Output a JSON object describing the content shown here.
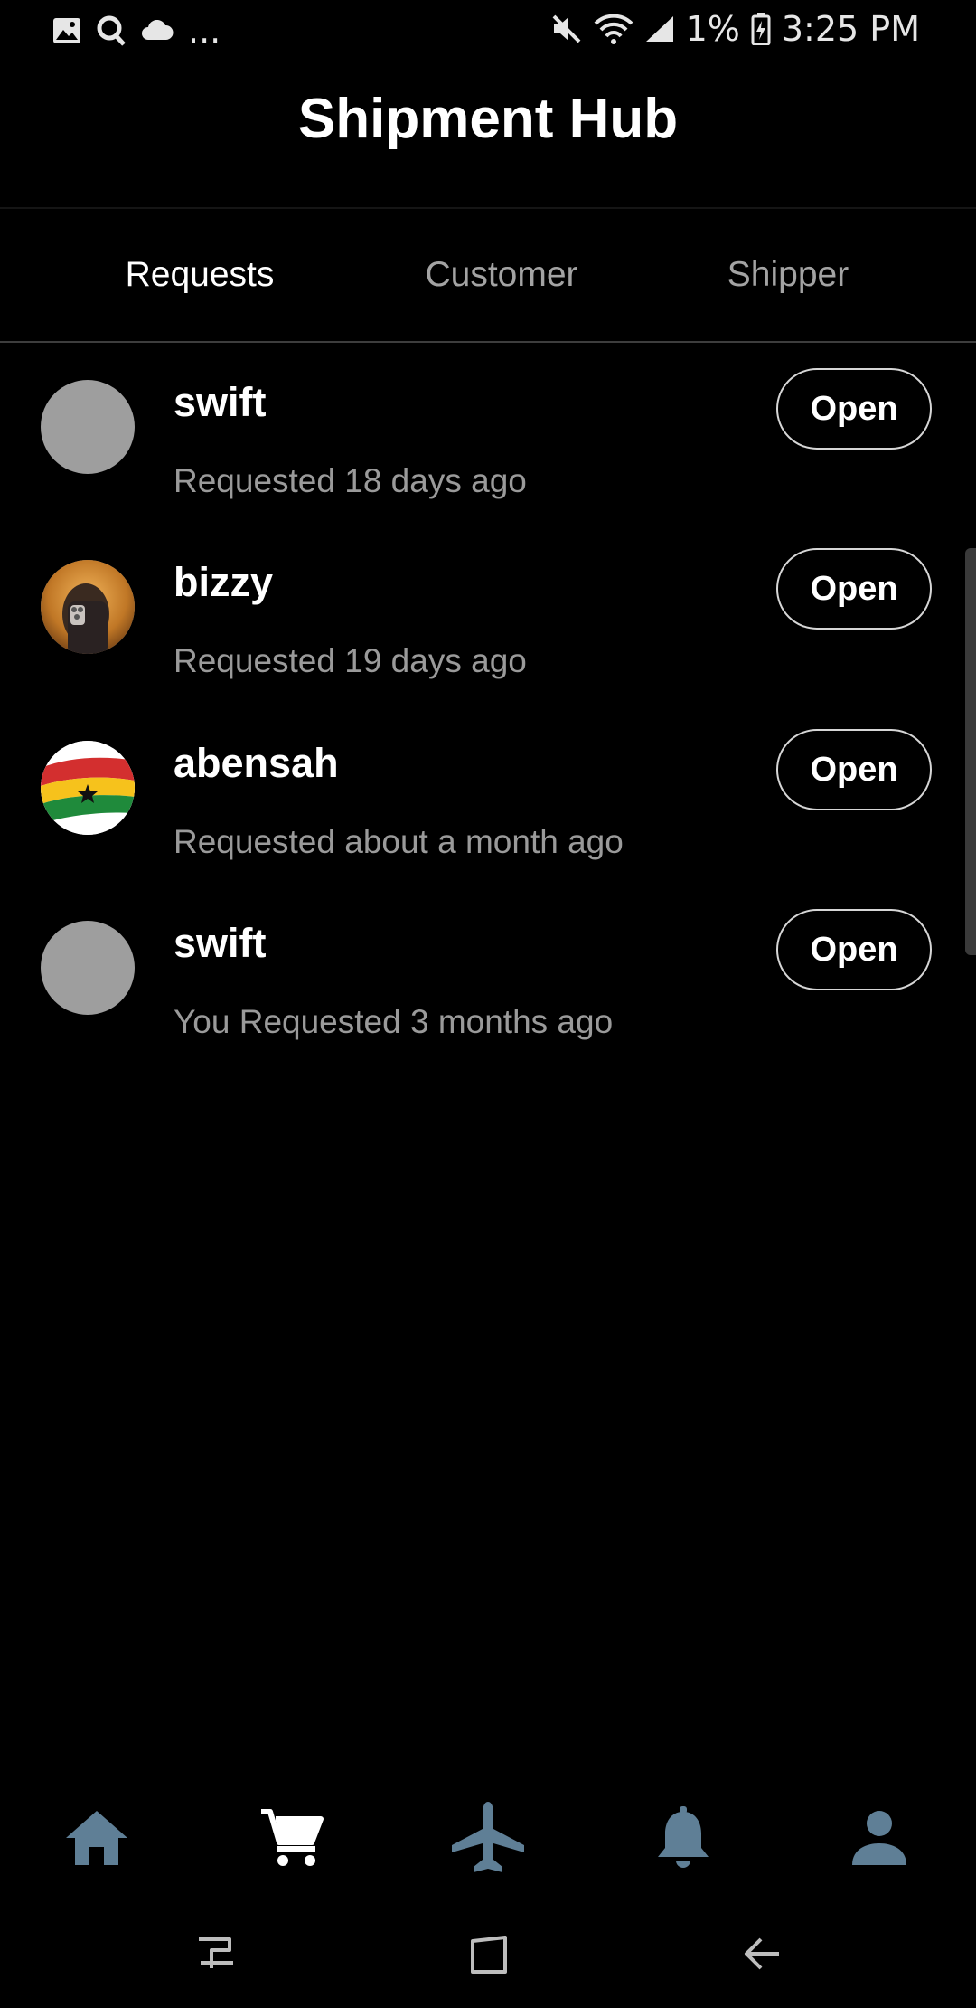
{
  "status_bar": {
    "battery_pct": "1%",
    "time": "3:25 PM",
    "more": "...",
    "icons": [
      "image-icon",
      "search-q-icon",
      "cloud-icon",
      "mute-icon",
      "wifi-icon",
      "signal-icon",
      "battery-charging-icon"
    ]
  },
  "header": {
    "title": "Shipment Hub"
  },
  "tabs": [
    {
      "label": "Requests",
      "active": true
    },
    {
      "label": "Customer",
      "active": false
    },
    {
      "label": "Shipper",
      "active": false
    }
  ],
  "requests": [
    {
      "name": "swift",
      "subtitle": "Requested 18 days ago",
      "action": "Open",
      "avatar": "placeholder"
    },
    {
      "name": "bizzy",
      "subtitle": "Requested 19 days ago",
      "action": "Open",
      "avatar": "photo"
    },
    {
      "name": "abensah",
      "subtitle": "Requested about a month ago",
      "action": "Open",
      "avatar": "ghana-flag"
    },
    {
      "name": "swift",
      "subtitle": "You Requested 3 months ago",
      "action": "Open",
      "avatar": "placeholder"
    }
  ],
  "bottom_nav": {
    "items": [
      "home-icon",
      "cart-icon",
      "airplane-icon",
      "bell-icon",
      "person-icon"
    ],
    "active": "cart-icon",
    "colors": {
      "active": "#ffffff",
      "inactive": "#5f7f96"
    }
  },
  "system_nav": [
    "recents-icon",
    "home-square-icon",
    "back-icon"
  ]
}
